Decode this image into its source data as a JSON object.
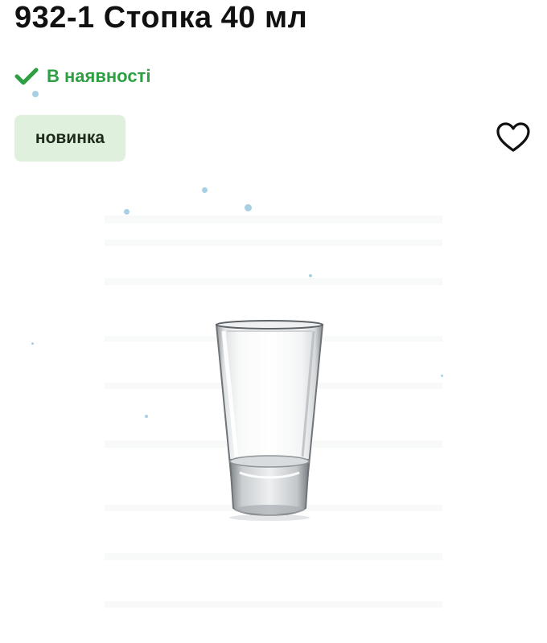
{
  "product": {
    "title": "932-1 Стопка 40 мл",
    "availability": {
      "label": "В наявності",
      "icon": "checkmark-icon",
      "color": "#2ea043"
    },
    "badge": {
      "label": "новинка",
      "background": "#dff0dc"
    },
    "favorite": {
      "icon": "heart-outline-icon"
    },
    "image": {
      "icon": "shot-glass-photo"
    }
  }
}
